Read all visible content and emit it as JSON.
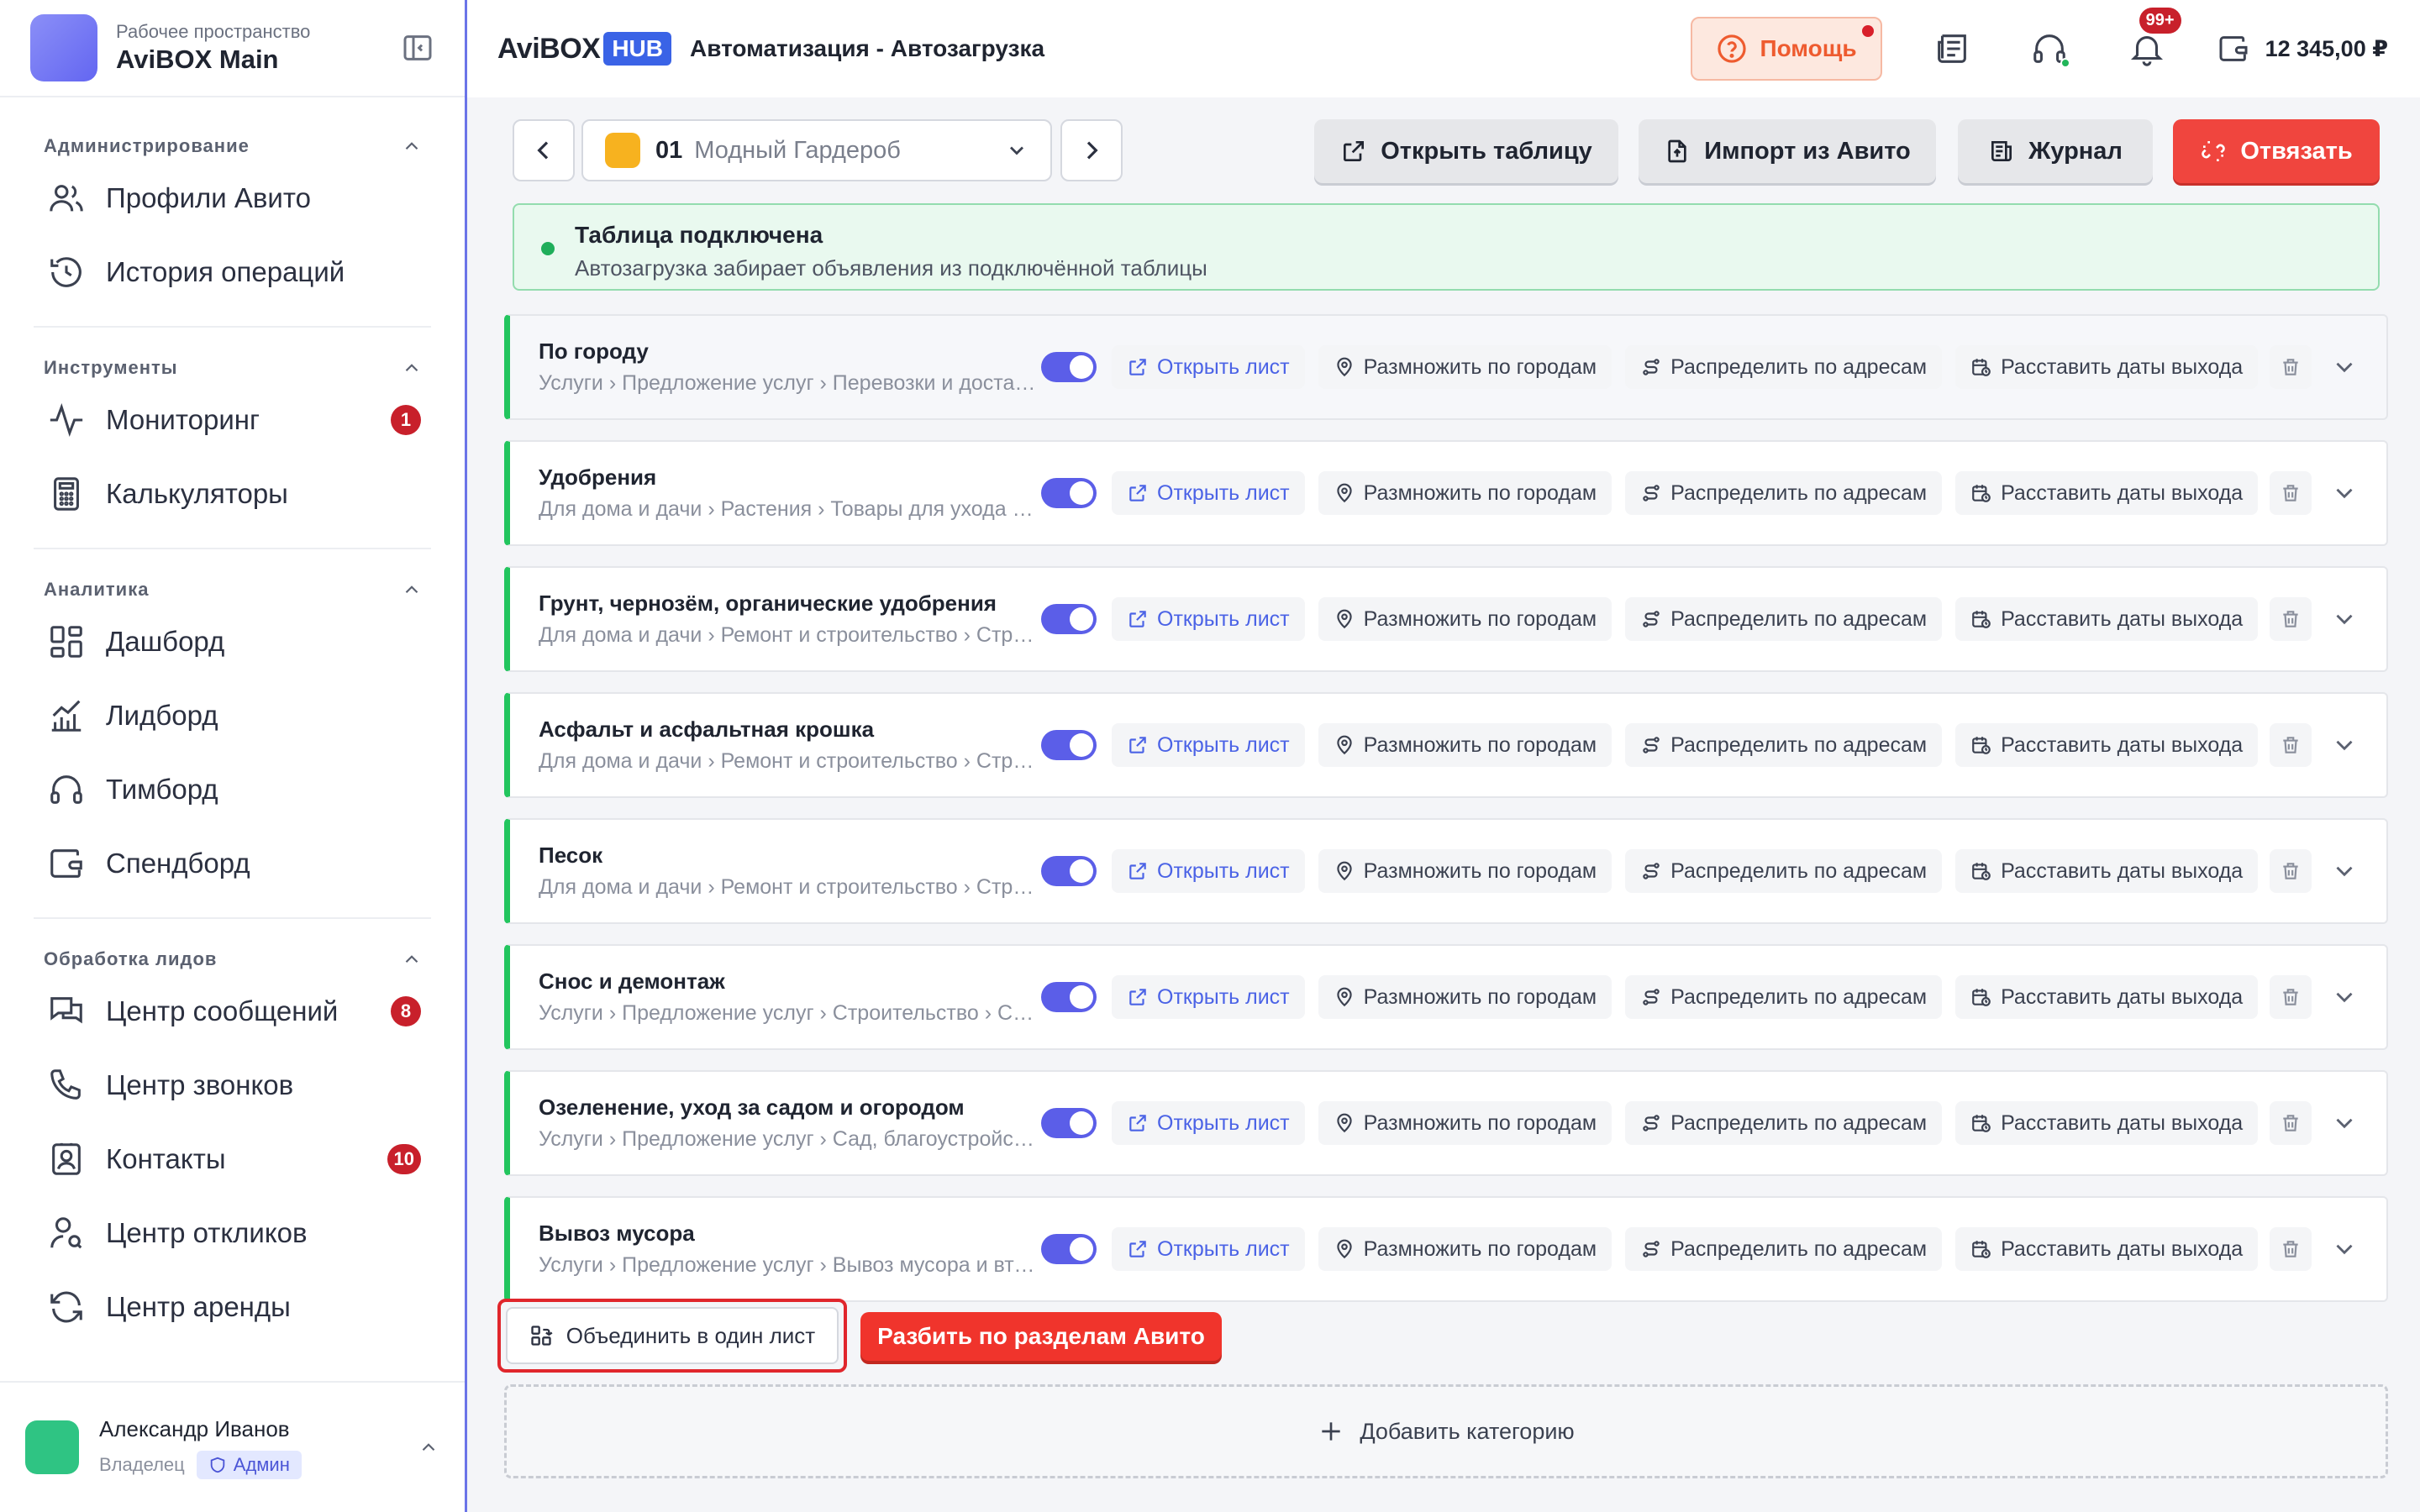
{
  "workspace": {
    "subtitle": "Рабочее пространство",
    "title": "AviBOX Main"
  },
  "sidebar": {
    "sections": [
      {
        "title": "Администрирование",
        "items": [
          {
            "label": "Профили Авито",
            "icon": "users-icon",
            "badge": ""
          },
          {
            "label": "История операций",
            "icon": "history-icon",
            "badge": ""
          }
        ]
      },
      {
        "title": "Инструменты",
        "items": [
          {
            "label": "Мониторинг",
            "icon": "activity-icon",
            "badge": "1"
          },
          {
            "label": "Калькуляторы",
            "icon": "calculator-icon",
            "badge": ""
          }
        ]
      },
      {
        "title": "Аналитика",
        "items": [
          {
            "label": "Дашборд",
            "icon": "dashboard-icon",
            "badge": ""
          },
          {
            "label": "Лидборд",
            "icon": "chart-icon",
            "badge": ""
          },
          {
            "label": "Тимборд",
            "icon": "headphones-icon",
            "badge": ""
          },
          {
            "label": "Спендборд",
            "icon": "wallet-icon",
            "badge": ""
          }
        ]
      },
      {
        "title": "Обработка лидов",
        "items": [
          {
            "label": "Центр сообщений",
            "icon": "messages-icon",
            "badge": "8"
          },
          {
            "label": "Центр звонков",
            "icon": "phone-icon",
            "badge": ""
          },
          {
            "label": "Контакты",
            "icon": "contacts-icon",
            "badge": "10"
          },
          {
            "label": "Центр откликов",
            "icon": "user-search-icon",
            "badge": ""
          },
          {
            "label": "Центр аренды",
            "icon": "refresh-icon",
            "badge": ""
          }
        ]
      }
    ]
  },
  "user": {
    "name": "Александр Иванов",
    "role": "Владелец",
    "badge": "Админ"
  },
  "header": {
    "brand_left": "AviBOX",
    "brand_right": "HUB",
    "title": "Автоматизация - Автозагрузка",
    "help_label": "Помощь",
    "notifications_badge": "99+",
    "balance": "12 345,00 ₽"
  },
  "toolbar": {
    "table_number": "01",
    "table_name": "Модный Гардероб",
    "open_table": "Открыть таблицу",
    "import": "Импорт из Авито",
    "journal": "Журнал",
    "unlink": "Отвязать"
  },
  "connection": {
    "title": "Таблица подключена",
    "subtitle": "Автозагрузка забирает объявления из подключённой таблицы"
  },
  "actions": {
    "open_sheet": "Открыть лист",
    "multiply": "Размножить по городам",
    "distribute": "Распределить по адресам",
    "dates": "Расставить даты выхода"
  },
  "categories": [
    {
      "title": "По городу",
      "path": "Услуги › Предложение услуг › Перевозки и доставка",
      "enabled": true
    },
    {
      "title": "Удобрения",
      "path": "Для дома и дачи › Растения › Товары для ухода за растениями",
      "enabled": true
    },
    {
      "title": "Грунт, чернозём, органические удобрения",
      "path": "Для дома и дачи › Ремонт и строительство › Стройматериалы",
      "enabled": true
    },
    {
      "title": "Асфальт и асфальтная крошка",
      "path": "Для дома и дачи › Ремонт и строительство › Стройматериалы",
      "enabled": true
    },
    {
      "title": "Песок",
      "path": "Для дома и дачи › Ремонт и строительство › Стройматериалы",
      "enabled": true
    },
    {
      "title": "Снос и демонтаж",
      "path": "Услуги › Предложение услуг › Строительство › Снос",
      "enabled": true
    },
    {
      "title": "Озеленение, уход за садом и огородом",
      "path": "Услуги › Предложение услуг › Сад, благоустройство",
      "enabled": true
    },
    {
      "title": "Вывоз мусора",
      "path": "Услуги › Предложение услуг › Вывоз мусора и вторсырья",
      "enabled": true
    }
  ],
  "footer": {
    "merge": "Объединить в один лист",
    "split": "Разбить по разделам Авито",
    "add_category": "Добавить категорию"
  },
  "colors": {
    "accent": "#5b5ee8",
    "danger": "#f0453e",
    "success": "#22c55e",
    "brand": "#3a63e6"
  }
}
